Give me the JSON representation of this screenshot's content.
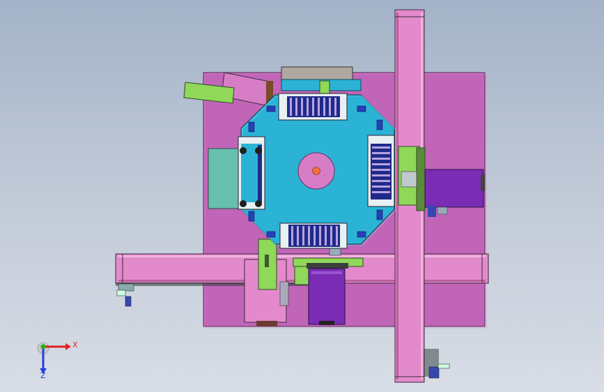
{
  "viewport": {
    "view": "top",
    "colors": {
      "background_top": "#a4b3c8",
      "background_bottom": "#d8dde6",
      "base_plate": "#c065b8",
      "conveyor_belt": "#e28acb",
      "rotary_table": "#2bb3d6",
      "table_hub": "#d77dc6",
      "hub_center": "#ef6f3d",
      "fixture_blue": "#2a3eb8",
      "motor_purple": "#7a2db4",
      "bracket_green": "#8fd85a",
      "panel_teal": "#67bfae"
    }
  },
  "triad": {
    "x_label": "X",
    "z_label": "Z",
    "x_color": "#e02020",
    "z_color": "#2040e0",
    "y_color": "#20b020"
  }
}
